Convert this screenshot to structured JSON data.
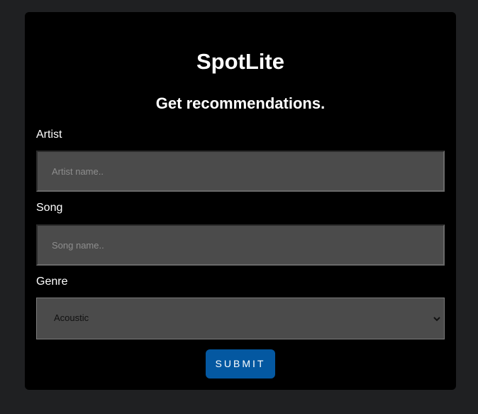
{
  "app": {
    "title": "SpotLite"
  },
  "form": {
    "heading": "Get recommendations.",
    "artist": {
      "label": "Artist",
      "placeholder": "Artist name.."
    },
    "song": {
      "label": "Song",
      "placeholder": "Song name.."
    },
    "genre": {
      "label": "Genre",
      "selected": "Acoustic",
      "icon": "chevron-down-icon"
    },
    "submit_label": "SUBMIT"
  },
  "colors": {
    "page_background": "#1f2022",
    "card_background": "#000000",
    "input_background": "#4b4b4b",
    "button_accent": "#0458a1"
  }
}
